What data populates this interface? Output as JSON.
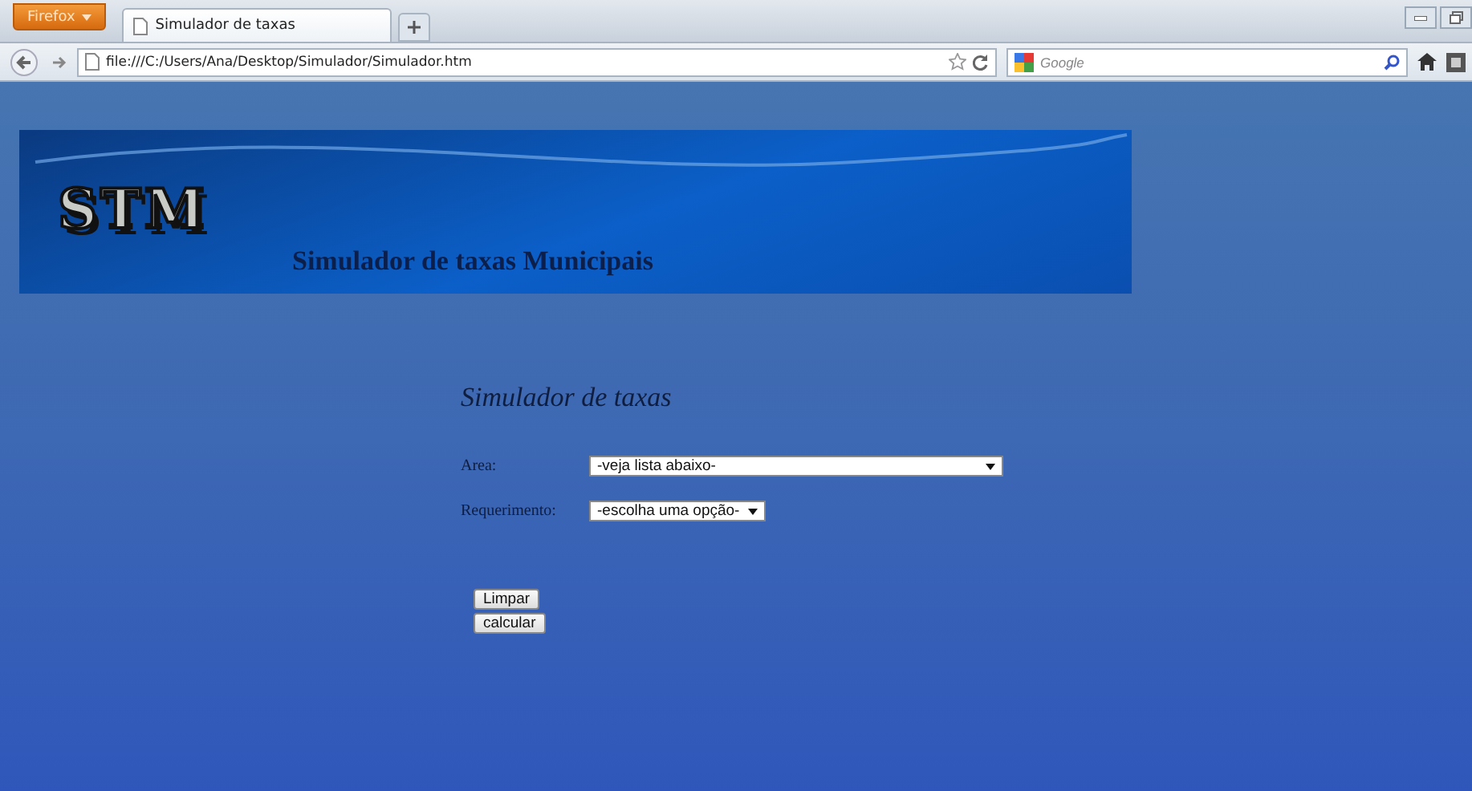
{
  "browser": {
    "menu_button": "Firefox",
    "tabs": [
      {
        "title": "Simulador de taxas"
      }
    ],
    "address": "file:///C:/Users/Ana/Desktop/Simulador/Simulador.htm",
    "search_placeholder": "Google"
  },
  "banner": {
    "logo": "STM",
    "subtitle": "Simulador de taxas Municipais"
  },
  "form": {
    "title": "Simulador de taxas",
    "fields": [
      {
        "label": "Area:",
        "value": "-veja lista abaixo-",
        "kind": "wide"
      },
      {
        "label": "Requerimento:",
        "value": "-escolha uma opção-",
        "kind": "narrow"
      }
    ],
    "buttons": [
      "Limpar",
      "calcular"
    ]
  }
}
